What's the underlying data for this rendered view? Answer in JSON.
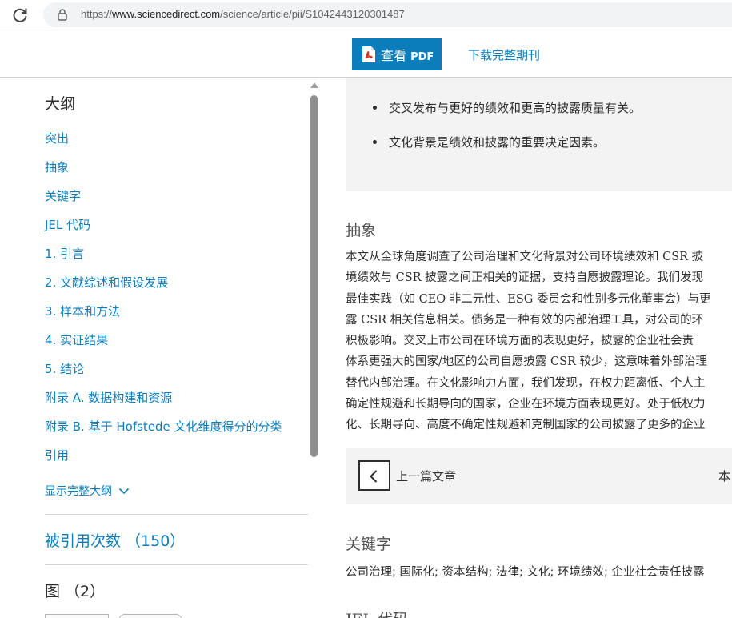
{
  "browser": {
    "url_prefix": "https://",
    "url_host": "www.sciencedirect.com",
    "url_path": "/science/article/pii/S1042443120301487"
  },
  "toolbar": {
    "pdf_label": "查看",
    "pdf_suffix": "PDF",
    "download_label": "下载完整期刊"
  },
  "sidebar": {
    "title": "大纲",
    "items": [
      {
        "label": "突出"
      },
      {
        "label": "抽象"
      },
      {
        "label": "关键字"
      },
      {
        "label": "JEL 代码"
      },
      {
        "label": "1. 引言"
      },
      {
        "label": "2. 文献综述和假设发展"
      },
      {
        "label": "3. 样本和方法"
      },
      {
        "label": "4. 实证结果"
      },
      {
        "label": "5. 结论"
      },
      {
        "label": "附录 A. 数据构建和资源"
      },
      {
        "label": "附录 B. 基于 Hofstede 文化维度得分的分类"
      },
      {
        "label": "引用"
      }
    ],
    "show_full": "显示完整大纲",
    "cited_by": "被引用次数 （150）",
    "figures": "图 （2）"
  },
  "main": {
    "highlights": [
      "交叉发布与更好的绩效和更高的披露质量有关。",
      "文化背景是绩效和披露的重要决定因素。"
    ],
    "abstract_heading": "抽象",
    "abstract_lines": [
      "本文从全球角度调查了公司治理和文化背景对公司环境绩效和 CSR 披",
      "境绩效与 CSR 披露之间正相关的证据，支持自愿披露理论。我们发现",
      "最佳实践（如 CEO 非二元性、ESG 委员会和性别多元化董事会）与更",
      "露 CSR 相关信息相关。债务是一种有效的内部治理工具，对公司的环",
      "积极影响。交叉上市公司在环境方面的表现更好，披露的企业社会责",
      "体系更强大的国家/地区的公司自愿披露 CSR 较少，这意味着外部治理",
      "替代内部治理。在文化影响力方面，我们发现，在权力距离低、个人主",
      "确定性规避和长期导向的国家，企业在环境方面表现更好。处于低权力",
      "化、长期导向、高度不确定性规避和克制国家的公司披露了更多的企业"
    ],
    "prev_article": "上一篇文章",
    "next_article": "本",
    "keywords_heading": "关键字",
    "keywords": "公司治理; 国际化; 资本结构; 法律; 文化; 环境绩效; 企业社会责任披露",
    "jel_heading": "JEL 代码"
  }
}
